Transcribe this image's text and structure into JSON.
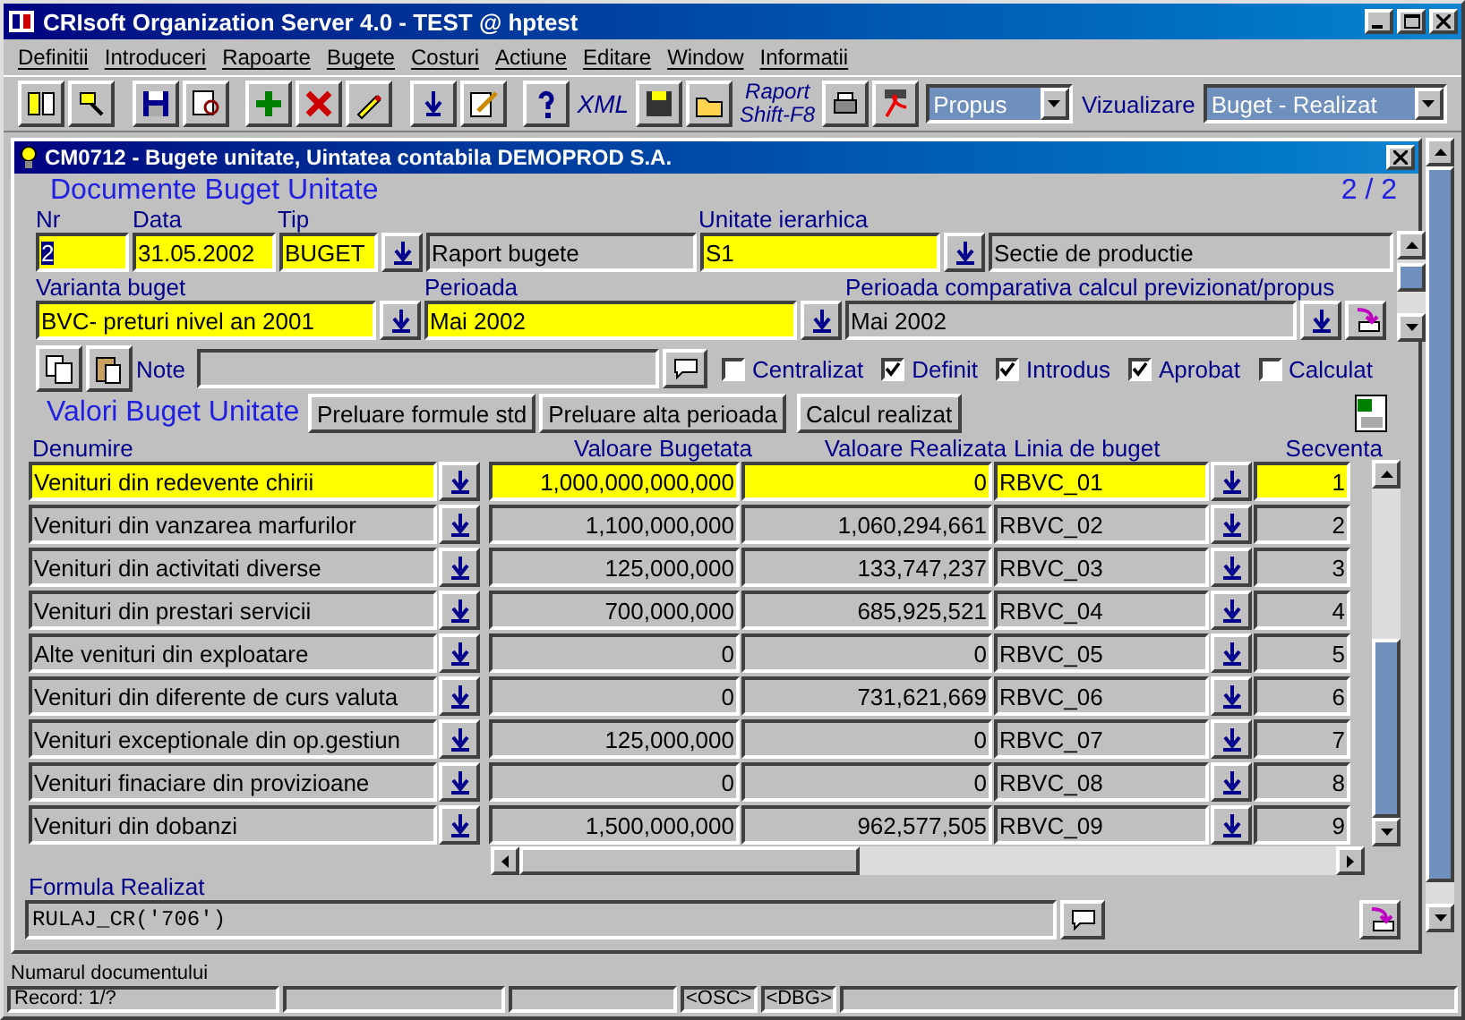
{
  "window": {
    "title": "CRIsoft Organization Server 4.0 - TEST @ hptest"
  },
  "menu": [
    "Definitii",
    "Introduceri",
    "Rapoarte",
    "Bugete",
    "Costuri",
    "Actiune",
    "Editare",
    "Window",
    "Informatii"
  ],
  "toolbar": {
    "xml_label": "XML",
    "report_button": [
      "Raport",
      "Shift-F8"
    ],
    "mode_select": "Propus",
    "view_label": "Vizualizare",
    "view_select": "Buget - Realizat"
  },
  "form": {
    "title": "CM0712 - Bugete unitate, Uintatea contabila DEMOPROD S.A.",
    "heading": "Documente Buget Unitate",
    "page": "2 / 2",
    "nr": {
      "label": "Nr",
      "value": "2"
    },
    "data": {
      "label": "Data",
      "value": "31.05.2002"
    },
    "tip": {
      "label": "Tip",
      "value": "BUGET",
      "description": "Raport bugete"
    },
    "unitate": {
      "label": "Unitate ierarhica",
      "value": "S1",
      "description": "Sectie de productie"
    },
    "varianta": {
      "label": "Varianta buget",
      "value": "BVC- preturi nivel an 2001"
    },
    "perioada": {
      "label": "Perioada",
      "value": "Mai 2002"
    },
    "perioada_comparativa": {
      "label": "Perioada comparativa calcul previzionat/propus",
      "value": "Mai 2002"
    },
    "note": {
      "label": "Note"
    },
    "flags": [
      {
        "label": "Centralizat",
        "checked": false
      },
      {
        "label": "Definit",
        "checked": true
      },
      {
        "label": "Introdus",
        "checked": true
      },
      {
        "label": "Aprobat",
        "checked": true
      },
      {
        "label": "Calculat",
        "checked": false
      }
    ],
    "section_title": "Valori Buget Unitate",
    "buttons": [
      "Preluare formule std",
      "Preluare alta perioada",
      "Calcul realizat"
    ],
    "table": {
      "columns": [
        "Denumire",
        "Valoare Bugetata",
        "Valoare Realizata",
        "Linia de buget",
        "Secventa"
      ],
      "rows": [
        {
          "name": "Venituri din redevente chirii",
          "budget": "1,000,000,000,000",
          "actual": "0",
          "line": "RBVC_01",
          "seq": "1",
          "selected": true
        },
        {
          "name": "Venituri din vanzarea marfurilor",
          "budget": "1,100,000,000",
          "actual": "1,060,294,661",
          "line": "RBVC_02",
          "seq": "2",
          "selected": false
        },
        {
          "name": "Venituri din activitati diverse",
          "budget": "125,000,000",
          "actual": "133,747,237",
          "line": "RBVC_03",
          "seq": "3",
          "selected": false
        },
        {
          "name": "Venituri din prestari servicii",
          "budget": "700,000,000",
          "actual": "685,925,521",
          "line": "RBVC_04",
          "seq": "4",
          "selected": false
        },
        {
          "name": "Alte venituri din exploatare",
          "budget": "0",
          "actual": "0",
          "line": "RBVC_05",
          "seq": "5",
          "selected": false
        },
        {
          "name": "Venituri din diferente de curs valuta",
          "budget": "0",
          "actual": "731,621,669",
          "line": "RBVC_06",
          "seq": "6",
          "selected": false
        },
        {
          "name": "Venituri exceptionale din op.gestiun",
          "budget": "125,000,000",
          "actual": "0",
          "line": "RBVC_07",
          "seq": "7",
          "selected": false
        },
        {
          "name": "Venituri finaciare din provizioane",
          "budget": "0",
          "actual": "0",
          "line": "RBVC_08",
          "seq": "8",
          "selected": false
        },
        {
          "name": "Venituri din dobanzi",
          "budget": "1,500,000,000",
          "actual": "962,577,505",
          "line": "RBVC_09",
          "seq": "9",
          "selected": false
        }
      ]
    },
    "formula": {
      "label": "Formula Realizat",
      "value": "RULAJ_CR('706')"
    }
  },
  "status_bar": {
    "message": "Numarul documentului",
    "record": "Record: 1/?",
    "indicators": [
      "<OSC>",
      "<DBG>"
    ]
  }
}
